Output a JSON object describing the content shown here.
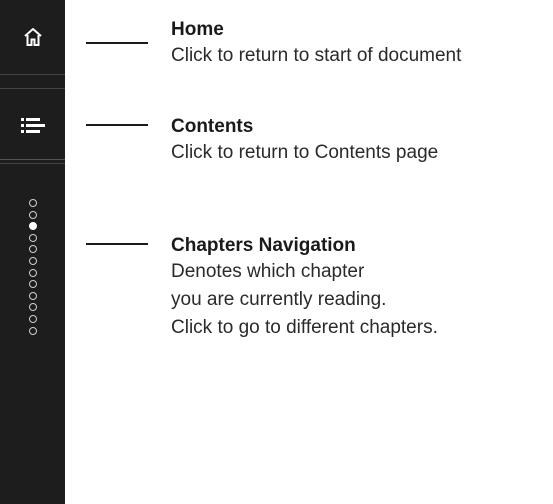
{
  "sidebar": {
    "home_icon": "home-icon",
    "contents_icon": "list-icon",
    "chapters": [
      {
        "active": false
      },
      {
        "active": false
      },
      {
        "active": true
      },
      {
        "active": false
      },
      {
        "active": false
      },
      {
        "active": false
      },
      {
        "active": false
      },
      {
        "active": false
      },
      {
        "active": false
      },
      {
        "active": false
      },
      {
        "active": false
      },
      {
        "active": false
      }
    ]
  },
  "callouts": {
    "home": {
      "title": "Home",
      "desc": "Click to return to start of document"
    },
    "contents": {
      "title": "Contents",
      "desc": "Click to return to Contents page"
    },
    "chapters": {
      "title": "Chapters Navigation",
      "line1": "Denotes which chapter",
      "line2": "you are currently reading.",
      "line3": "Click to go to different chapters."
    }
  },
  "colors": {
    "sidebar_bg": "#1d1d1d",
    "text": "#1a1a1a",
    "dot_active": "#ffffff"
  }
}
